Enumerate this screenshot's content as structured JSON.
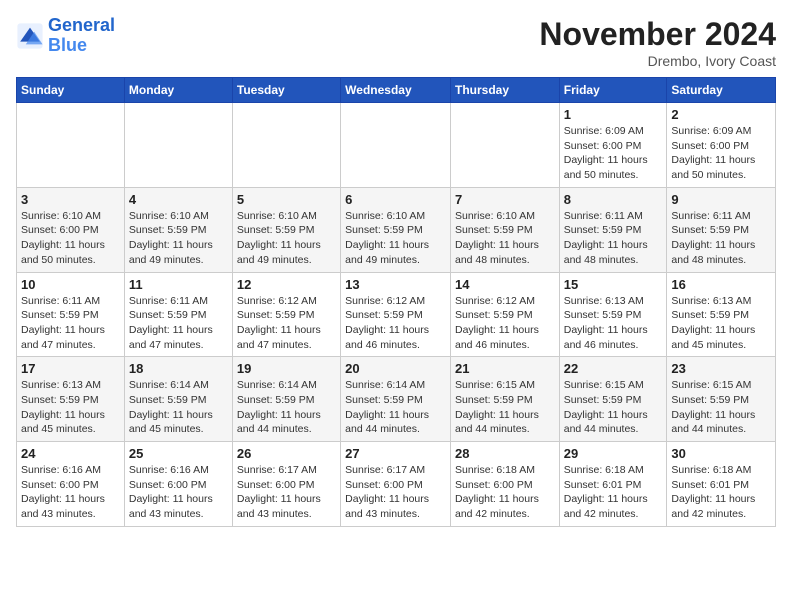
{
  "header": {
    "logo_general": "General",
    "logo_blue": "Blue",
    "month_title": "November 2024",
    "location": "Drembo, Ivory Coast"
  },
  "weekdays": [
    "Sunday",
    "Monday",
    "Tuesday",
    "Wednesday",
    "Thursday",
    "Friday",
    "Saturday"
  ],
  "weeks": [
    [
      {
        "day": "",
        "info": ""
      },
      {
        "day": "",
        "info": ""
      },
      {
        "day": "",
        "info": ""
      },
      {
        "day": "",
        "info": ""
      },
      {
        "day": "",
        "info": ""
      },
      {
        "day": "1",
        "info": "Sunrise: 6:09 AM\nSunset: 6:00 PM\nDaylight: 11 hours and 50 minutes."
      },
      {
        "day": "2",
        "info": "Sunrise: 6:09 AM\nSunset: 6:00 PM\nDaylight: 11 hours and 50 minutes."
      }
    ],
    [
      {
        "day": "3",
        "info": "Sunrise: 6:10 AM\nSunset: 6:00 PM\nDaylight: 11 hours and 50 minutes."
      },
      {
        "day": "4",
        "info": "Sunrise: 6:10 AM\nSunset: 5:59 PM\nDaylight: 11 hours and 49 minutes."
      },
      {
        "day": "5",
        "info": "Sunrise: 6:10 AM\nSunset: 5:59 PM\nDaylight: 11 hours and 49 minutes."
      },
      {
        "day": "6",
        "info": "Sunrise: 6:10 AM\nSunset: 5:59 PM\nDaylight: 11 hours and 49 minutes."
      },
      {
        "day": "7",
        "info": "Sunrise: 6:10 AM\nSunset: 5:59 PM\nDaylight: 11 hours and 48 minutes."
      },
      {
        "day": "8",
        "info": "Sunrise: 6:11 AM\nSunset: 5:59 PM\nDaylight: 11 hours and 48 minutes."
      },
      {
        "day": "9",
        "info": "Sunrise: 6:11 AM\nSunset: 5:59 PM\nDaylight: 11 hours and 48 minutes."
      }
    ],
    [
      {
        "day": "10",
        "info": "Sunrise: 6:11 AM\nSunset: 5:59 PM\nDaylight: 11 hours and 47 minutes."
      },
      {
        "day": "11",
        "info": "Sunrise: 6:11 AM\nSunset: 5:59 PM\nDaylight: 11 hours and 47 minutes."
      },
      {
        "day": "12",
        "info": "Sunrise: 6:12 AM\nSunset: 5:59 PM\nDaylight: 11 hours and 47 minutes."
      },
      {
        "day": "13",
        "info": "Sunrise: 6:12 AM\nSunset: 5:59 PM\nDaylight: 11 hours and 46 minutes."
      },
      {
        "day": "14",
        "info": "Sunrise: 6:12 AM\nSunset: 5:59 PM\nDaylight: 11 hours and 46 minutes."
      },
      {
        "day": "15",
        "info": "Sunrise: 6:13 AM\nSunset: 5:59 PM\nDaylight: 11 hours and 46 minutes."
      },
      {
        "day": "16",
        "info": "Sunrise: 6:13 AM\nSunset: 5:59 PM\nDaylight: 11 hours and 45 minutes."
      }
    ],
    [
      {
        "day": "17",
        "info": "Sunrise: 6:13 AM\nSunset: 5:59 PM\nDaylight: 11 hours and 45 minutes."
      },
      {
        "day": "18",
        "info": "Sunrise: 6:14 AM\nSunset: 5:59 PM\nDaylight: 11 hours and 45 minutes."
      },
      {
        "day": "19",
        "info": "Sunrise: 6:14 AM\nSunset: 5:59 PM\nDaylight: 11 hours and 44 minutes."
      },
      {
        "day": "20",
        "info": "Sunrise: 6:14 AM\nSunset: 5:59 PM\nDaylight: 11 hours and 44 minutes."
      },
      {
        "day": "21",
        "info": "Sunrise: 6:15 AM\nSunset: 5:59 PM\nDaylight: 11 hours and 44 minutes."
      },
      {
        "day": "22",
        "info": "Sunrise: 6:15 AM\nSunset: 5:59 PM\nDaylight: 11 hours and 44 minutes."
      },
      {
        "day": "23",
        "info": "Sunrise: 6:15 AM\nSunset: 5:59 PM\nDaylight: 11 hours and 44 minutes."
      }
    ],
    [
      {
        "day": "24",
        "info": "Sunrise: 6:16 AM\nSunset: 6:00 PM\nDaylight: 11 hours and 43 minutes."
      },
      {
        "day": "25",
        "info": "Sunrise: 6:16 AM\nSunset: 6:00 PM\nDaylight: 11 hours and 43 minutes."
      },
      {
        "day": "26",
        "info": "Sunrise: 6:17 AM\nSunset: 6:00 PM\nDaylight: 11 hours and 43 minutes."
      },
      {
        "day": "27",
        "info": "Sunrise: 6:17 AM\nSunset: 6:00 PM\nDaylight: 11 hours and 43 minutes."
      },
      {
        "day": "28",
        "info": "Sunrise: 6:18 AM\nSunset: 6:00 PM\nDaylight: 11 hours and 42 minutes."
      },
      {
        "day": "29",
        "info": "Sunrise: 6:18 AM\nSunset: 6:01 PM\nDaylight: 11 hours and 42 minutes."
      },
      {
        "day": "30",
        "info": "Sunrise: 6:18 AM\nSunset: 6:01 PM\nDaylight: 11 hours and 42 minutes."
      }
    ]
  ]
}
